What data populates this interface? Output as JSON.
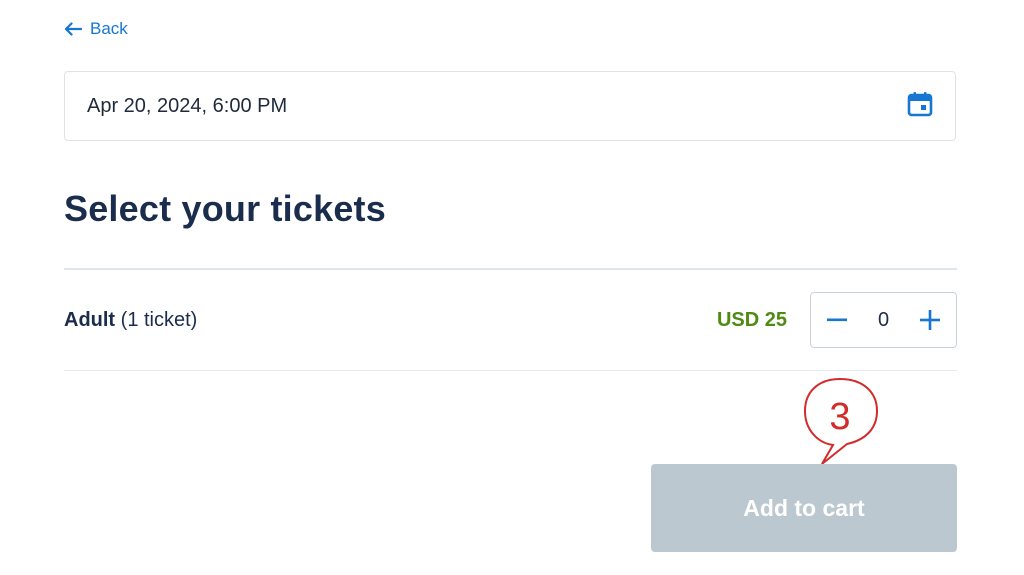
{
  "nav": {
    "back_label": "Back"
  },
  "date_picker": {
    "value": "Apr 20, 2024, 6:00 PM",
    "icon": "calendar-icon"
  },
  "heading": "Select your tickets",
  "ticket": {
    "type": "Adult",
    "count_text": "(1 ticket)",
    "price": "USD 25",
    "quantity": "0",
    "minus_icon": "minus-icon",
    "plus_icon": "plus-icon"
  },
  "annotation": {
    "number": "3"
  },
  "cart_button": {
    "label": "Add to cart"
  },
  "colors": {
    "accent": "#1677d2",
    "price": "#4f8a12",
    "disabled_button": "#bcc8d0",
    "annotation": "#d22b2b",
    "heading": "#1b2d4c"
  }
}
